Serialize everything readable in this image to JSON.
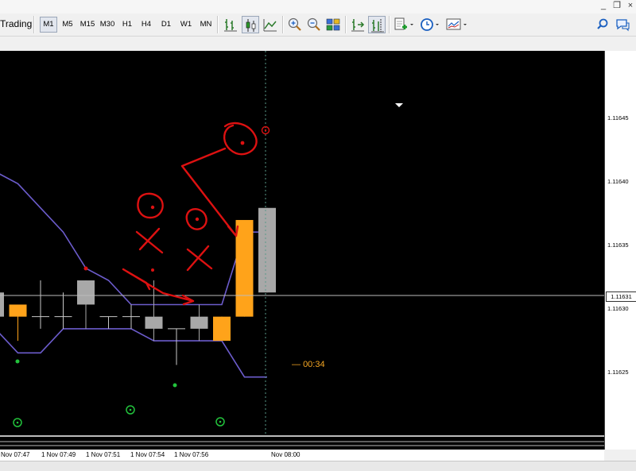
{
  "app": {
    "menu_label": "Trading",
    "window_buttons": [
      "_",
      "❐",
      "×"
    ]
  },
  "toolbar": {
    "timeframes": [
      "M1",
      "M5",
      "M15",
      "M30",
      "H1",
      "H4",
      "D1",
      "W1",
      "MN"
    ],
    "active_timeframe": "M1",
    "icons": [
      "bar-chart-icon",
      "candlestick-chart-icon",
      "line-chart-icon",
      "zoom-in-icon",
      "zoom-out-icon",
      "tile-windows-icon",
      "autoscroll-icon",
      "chart-shift-icon",
      "indicators-icon",
      "periods-icon",
      "templates-icon",
      "search-icon",
      "chat-icon"
    ]
  },
  "chart_data": {
    "type": "candlestick",
    "symbol_timeframe": "M1",
    "price_axis_labels": [
      "1.11645",
      "1.11640",
      "1.11635",
      "1.11630",
      "1.11625"
    ],
    "current_price": "1.11631",
    "time_axis_labels": [
      "Nov 07:47",
      "1 Nov 07:49",
      "1 Nov 07:51",
      "1 Nov 07:54",
      "1 Nov 07:56",
      "Nov 08:00"
    ],
    "countdown": "00:34",
    "ylim": [
      1.11618,
      1.11651
    ],
    "candles": [
      {
        "open": 1.11631,
        "high": 1.11633,
        "low": 1.11629,
        "close": 1.11629,
        "color": "gray"
      },
      {
        "open": 1.1163,
        "high": 1.1163,
        "low": 1.11627,
        "close": 1.11629,
        "color": "orange"
      },
      {
        "open": 1.11629,
        "high": 1.11632,
        "low": 1.11628,
        "close": 1.11629,
        "color": "cross"
      },
      {
        "open": 1.11629,
        "high": 1.11631,
        "low": 1.11628,
        "close": 1.11629,
        "color": "cross"
      },
      {
        "open": 1.1163,
        "high": 1.11632,
        "low": 1.11628,
        "close": 1.11632,
        "color": "gray"
      },
      {
        "open": 1.11629,
        "high": 1.11629,
        "low": 1.11628,
        "close": 1.11629,
        "color": "cross"
      },
      {
        "open": 1.11629,
        "high": 1.1163,
        "low": 1.11628,
        "close": 1.11629,
        "color": "cross"
      },
      {
        "open": 1.11628,
        "high": 1.11632,
        "low": 1.11627,
        "close": 1.11629,
        "color": "gray"
      },
      {
        "open": 1.11628,
        "high": 1.11628,
        "low": 1.11625,
        "close": 1.11628,
        "color": "cross"
      },
      {
        "open": 1.11628,
        "high": 1.1163,
        "low": 1.11627,
        "close": 1.11629,
        "color": "gray"
      },
      {
        "open": 1.11629,
        "high": 1.11629,
        "low": 1.11627,
        "close": 1.11627,
        "color": "orange"
      },
      {
        "open": 1.11629,
        "high": 1.11637,
        "low": 1.11629,
        "close": 1.11637,
        "color": "orange"
      },
      {
        "open": 1.11631,
        "high": 1.11638,
        "low": 1.11631,
        "close": 1.11638,
        "color": "gray"
      }
    ],
    "upper_band": [
      1.11641,
      1.1164,
      1.11638,
      1.11636,
      1.11633,
      1.11632,
      1.1163,
      1.1163,
      1.1163,
      1.1163,
      1.1163,
      1.11636,
      1.11636
    ],
    "lower_band": [
      1.11628,
      1.11626,
      1.11626,
      1.11628,
      1.11628,
      1.11628,
      1.11628,
      1.11627,
      1.11627,
      1.11627,
      1.11627,
      1.11624,
      1.11624
    ],
    "colors": {
      "background": "#000000",
      "bull_candle": "#ffa31a",
      "bear_candle": "#a8a8a8",
      "band": "#6c5ccc",
      "signal_green": "#22c33c",
      "annotation_red": "#dd1111",
      "countdown": "#f5a623"
    }
  }
}
